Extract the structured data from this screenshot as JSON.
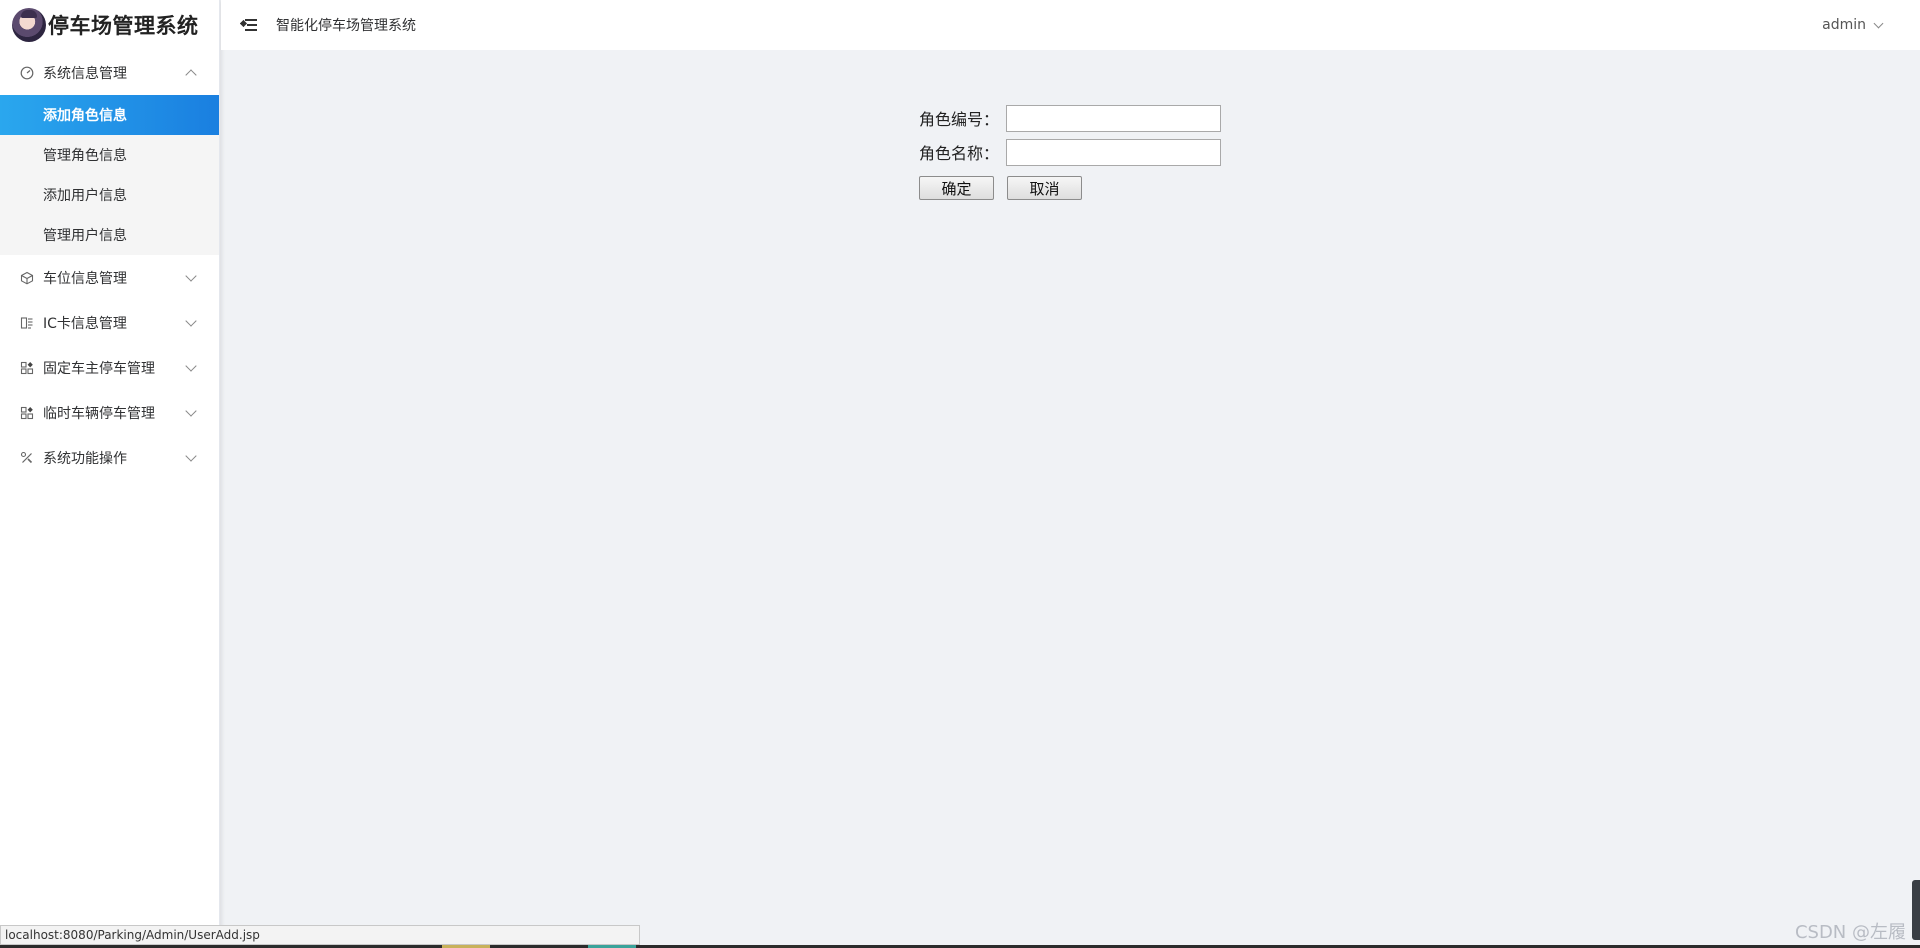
{
  "app": {
    "brand_title": "停车场管理系统"
  },
  "header": {
    "title": "智能化停车场管理系统",
    "user": "admin"
  },
  "sidebar": {
    "groups": [
      {
        "label": "系统信息管理",
        "icon": "gauge-icon",
        "expanded": true,
        "items": [
          {
            "label": "添加角色信息",
            "active": true
          },
          {
            "label": "管理角色信息"
          },
          {
            "label": "添加用户信息"
          },
          {
            "label": "管理用户信息"
          }
        ]
      },
      {
        "label": "车位信息管理",
        "icon": "cube-icon",
        "expanded": false
      },
      {
        "label": "IC卡信息管理",
        "icon": "card-icon",
        "expanded": false
      },
      {
        "label": "固定车主停车管理",
        "icon": "apps-icon",
        "expanded": false
      },
      {
        "label": "临时车辆停车管理",
        "icon": "apps-icon",
        "expanded": false
      },
      {
        "label": "系统功能操作",
        "icon": "tools-icon",
        "expanded": false
      }
    ]
  },
  "form": {
    "role_id_label": "角色编号：",
    "role_id_value": "",
    "role_name_label": "角色名称：",
    "role_name_value": "",
    "confirm_label": "确定",
    "cancel_label": "取消"
  },
  "status_bar": {
    "url": "localhost:8080/Parking/Admin/UserAdd.jsp"
  },
  "watermark": "CSDN @左履",
  "colors": {
    "active_start": "#2aa7ee",
    "active_end": "#1a7fe0",
    "background": "#f0f2f5"
  }
}
